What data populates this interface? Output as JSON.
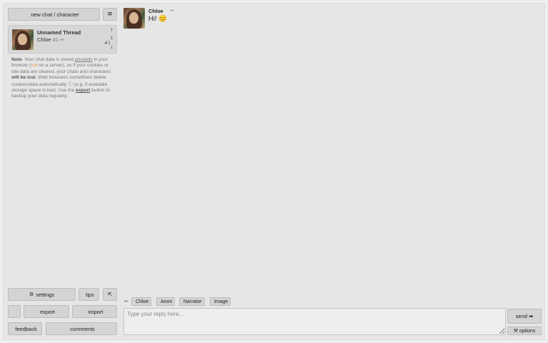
{
  "sidebar": {
    "new_chat_label": "new chat / character",
    "new_chat_icon": "",
    "menu_icon": "≡",
    "thread": {
      "title": "Unnamed Thread",
      "character": "Chloe",
      "id_label": "#1",
      "edit_icon": "✏",
      "count": "#1",
      "up_icon": "↑",
      "mid_icon": "↕",
      "down_icon": "↓"
    },
    "note": {
      "label": "Note",
      "p1": ". Your chat data is stored ",
      "privately": "privately",
      "p2": " in your browser (",
      "not_word": "not",
      "p3": " on a server), so if your cookies or site data are cleared, your chats and characters ",
      "will_be_lost": "will be lost",
      "p4": ". Web browsers sometimes delete cookies/data automatically ",
      "help_icon": "ⓘ",
      "p5": " (e.g. if available storage space is low). Use the ",
      "export_word": "export",
      "p6": " button to backup your data regularly."
    },
    "bottom": {
      "settings_icon": "⚙",
      "settings_label": "settings",
      "tips_icon": "",
      "tips_label": "tips",
      "collapse_icon": "⇱",
      "small_icon": "",
      "export_icon": "",
      "export_label": "export",
      "import_icon": "",
      "import_label": "import",
      "feedback_icon": "",
      "feedback_label": "feedback",
      "comments_icon": "",
      "comments_label": "comments"
    }
  },
  "message": {
    "name": "Chloe",
    "edit_icon": "✏",
    "icon_a": "",
    "icon_b": "",
    "text": "Hi! 😊"
  },
  "reply_bar": {
    "pencil_icon": "✏",
    "chips": [
      {
        "icon": "",
        "label": "Chloe"
      },
      {
        "icon": "",
        "label": "Anon"
      },
      {
        "icon": "",
        "label": "Narrator"
      },
      {
        "icon": "",
        "label": "Image"
      }
    ],
    "placeholder": "Type your reply here...",
    "send_label": "send ➡",
    "options_label": "⚒ options"
  }
}
